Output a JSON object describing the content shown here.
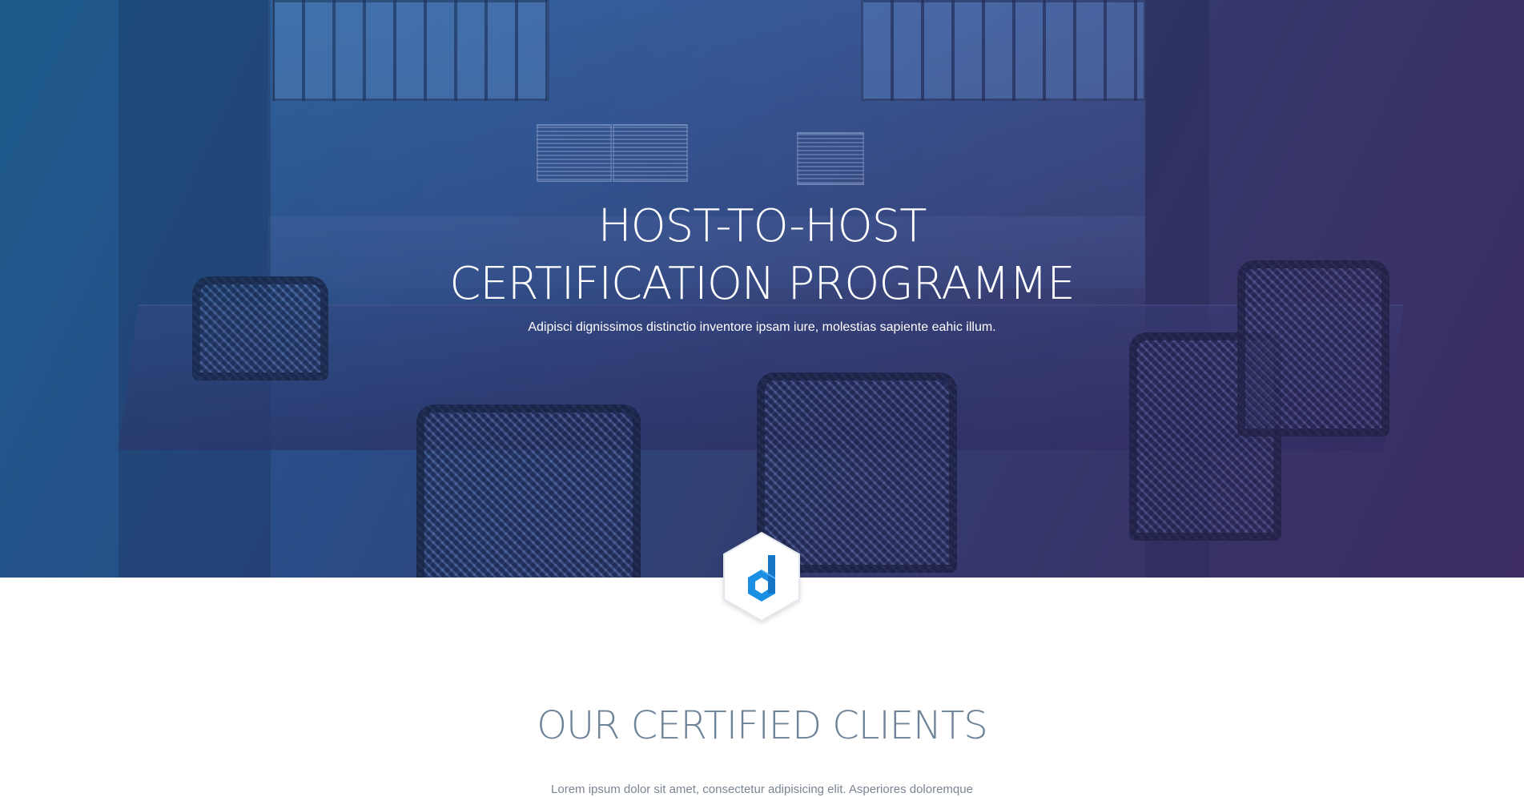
{
  "hero": {
    "title_line1": "HOST-TO-HOST",
    "title_line2": "CERTIFICATION PROGRAMME",
    "subtitle": "Adipisci dignissimos distinctio inventore ipsam iure, molestias sapiente eahic illum."
  },
  "logo": {
    "icon": "d-hexagon-logo-icon",
    "accent": "#1a8fe3"
  },
  "clients_section": {
    "title": "OUR CERTIFIED CLIENTS",
    "text": "Lorem ipsum dolor sit amet, consectetur adipisicing elit. Asperiores doloremque"
  },
  "colors": {
    "gradient_start": "#1d5a8a",
    "gradient_end": "#3b2f5e",
    "section_title": "#6e8398"
  }
}
